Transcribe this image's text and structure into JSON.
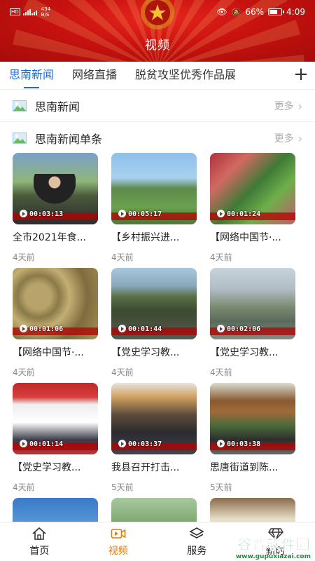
{
  "status_bar": {
    "left_text": "HD",
    "net_speed_top": "434",
    "net_speed_bottom": "B/S",
    "battery_pct": "66%",
    "time": "4:09"
  },
  "header": {
    "title": "视频"
  },
  "tabs": [
    {
      "label": "思南新闻",
      "active": true
    },
    {
      "label": "网络直播",
      "active": false
    },
    {
      "label": "脱贫攻坚优秀作品展",
      "active": false
    }
  ],
  "add_tab_label": "+",
  "sections": [
    {
      "title": "思南新闻",
      "more": "更多"
    },
    {
      "title": "思南新闻单条",
      "more": "更多"
    }
  ],
  "videos": [
    {
      "title": "全市2021年食...",
      "duration": "00:03:13",
      "time": "4天前"
    },
    {
      "title": "【乡村振兴进...",
      "duration": "00:05:17",
      "time": "4天前"
    },
    {
      "title": "【网络中国节·...",
      "duration": "00:01:24",
      "time": "4天前"
    },
    {
      "title": "【网络中国节·...",
      "duration": "00:01:06",
      "time": "4天前"
    },
    {
      "title": "【党史学习教...",
      "duration": "00:01:44",
      "time": "4天前"
    },
    {
      "title": "【党史学习教...",
      "duration": "00:02:06",
      "time": "4天前"
    },
    {
      "title": "【党史学习教...",
      "duration": "00:01:14",
      "time": "4天前"
    },
    {
      "title": "我县召开打击...",
      "duration": "00:03:37",
      "time": "5天前"
    },
    {
      "title": "思唐街道到陈...",
      "duration": "00:03:38",
      "time": "5天前"
    }
  ],
  "bottom_nav": [
    {
      "label": "首页",
      "icon": "home-icon",
      "active": false
    },
    {
      "label": "视频",
      "icon": "video-icon",
      "active": true
    },
    {
      "label": "服务",
      "icon": "layers-icon",
      "active": false
    },
    {
      "label": "新时",
      "icon": "diamond-icon",
      "active": false
    }
  ],
  "watermark": {
    "main": "谷普软件园",
    "url": "www.gupuxiazai.com"
  },
  "colors": {
    "header_red": "#c8120f",
    "accent_blue": "#1b6fd6",
    "nav_active": "#e07b00"
  }
}
